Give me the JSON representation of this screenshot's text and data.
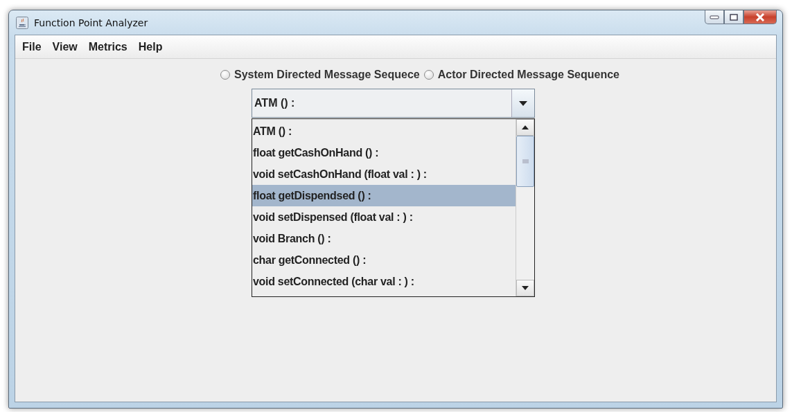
{
  "window": {
    "title": "Function Point Analyzer"
  },
  "menu": [
    "File",
    "View",
    "Metrics",
    "Help"
  ],
  "radios": [
    {
      "label": "System Directed Message Sequece",
      "selected": false
    },
    {
      "label": "Actor Directed Message Sequence",
      "selected": false
    }
  ],
  "combo": {
    "value": "ATM () :"
  },
  "list": [
    {
      "label": "ATM () :",
      "selected": false
    },
    {
      "label": "float getCashOnHand () :",
      "selected": false
    },
    {
      "label": "void setCashOnHand (float val : ) :",
      "selected": false
    },
    {
      "label": "float getDispendsed () :",
      "selected": true
    },
    {
      "label": "void setDispensed (float val : ) :",
      "selected": false
    },
    {
      "label": "void Branch () :",
      "selected": false
    },
    {
      "label": "char getConnected () :",
      "selected": false
    },
    {
      "label": "void setConnected (char val : ) :",
      "selected": false
    }
  ]
}
